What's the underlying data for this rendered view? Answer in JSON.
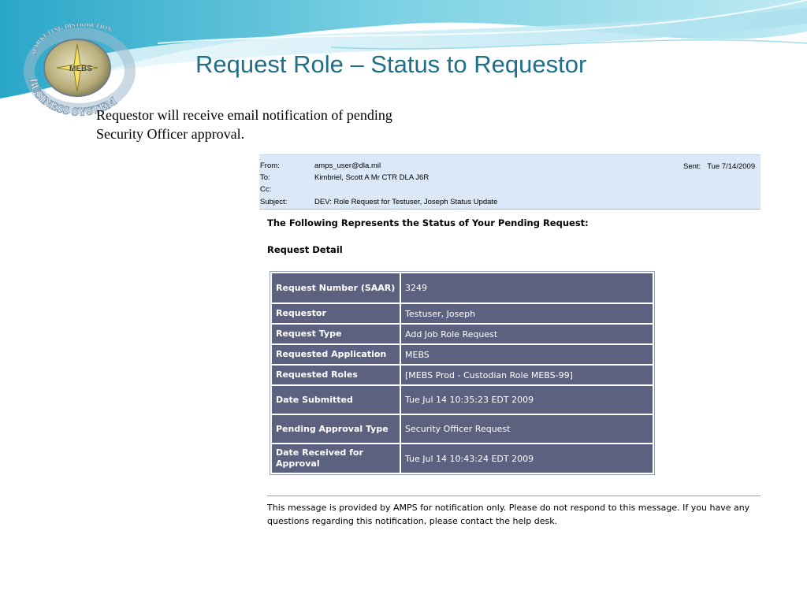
{
  "slide": {
    "title": "Request Role – Status to Requestor",
    "intro": "Requestor will receive email notification of pending Security Officer approval."
  },
  "email": {
    "headers": [
      {
        "label": "From:",
        "value": "amps_user@dla.mil"
      },
      {
        "label": "To:",
        "value": "Kimbriel, Scott A Mr CTR DLA J6R"
      },
      {
        "label": "Cc:",
        "value": ""
      },
      {
        "label": "Subject:",
        "value": "DEV:   Role Request for Testuser, Joseph Status Update"
      }
    ],
    "sent_label": "Sent:",
    "sent_value": "Tue 7/14/2009",
    "body_heading": "The Following Represents the Status of Your Pending Request:",
    "section_title": "Request Detail",
    "details": [
      {
        "label": "Request Number (SAAR)",
        "value": "3249"
      },
      {
        "label": "Requestor",
        "value": "Testuser, Joseph"
      },
      {
        "label": "Request Type",
        "value": "Add Job Role Request"
      },
      {
        "label": "Requested Application",
        "value": "MEBS"
      },
      {
        "label": "Requested Roles",
        "value": "[MEBS Prod - Custodian Role MEBS-99]"
      },
      {
        "label": "Date Submitted",
        "value": "Tue Jul 14 10:35:23 EDT 2009"
      },
      {
        "label": "Pending Approval Type",
        "value": "Security Officer Request"
      },
      {
        "label": "Date Received for Approval",
        "value": "Tue Jul 14 10:43:24 EDT 2009"
      }
    ],
    "footer": "This message is provided by AMPS for notification only. Please do not respond to this message.  If you have any questions regarding this notification, please contact the help desk."
  },
  "logo": {
    "ring_text": "BUSINESS SYSTEM",
    "top_text": "MARKETING DISTRIBUTION",
    "center_text": "MEBS"
  },
  "colors": {
    "title": "#1f6e8a",
    "header_bg": "#dbe8f7",
    "table_cell": "#5c6180"
  }
}
